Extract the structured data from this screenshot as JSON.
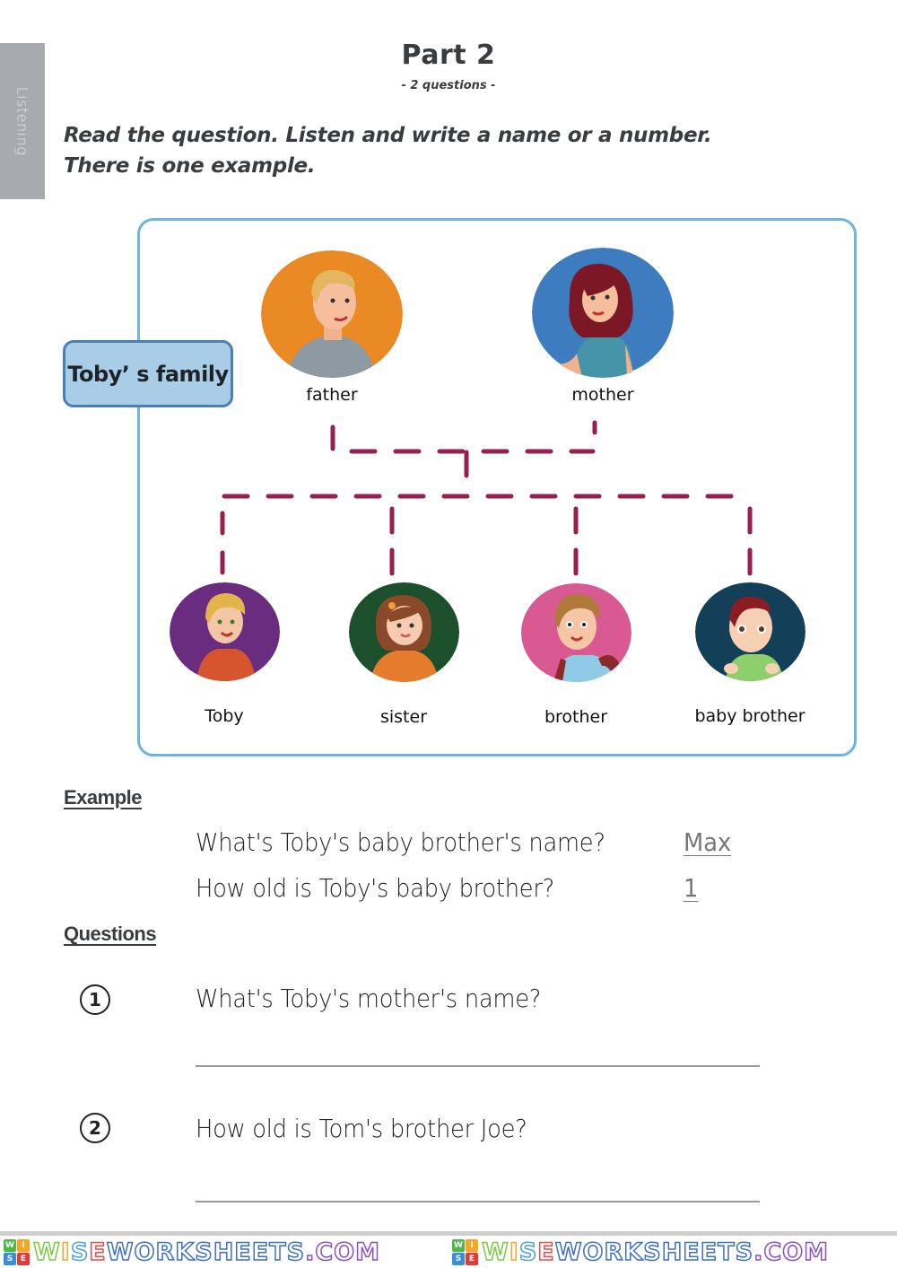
{
  "side_tab": {
    "label": "Listening"
  },
  "header": {
    "title": "Part 2",
    "subtitle": "- 2 questions -",
    "instruction_line1": "Read the question. Listen and write a name or a number.",
    "instruction_line2": "There is one example."
  },
  "family": {
    "tag": "Toby’ s family",
    "parents": [
      {
        "label": "father",
        "bg_color": "#e98a25"
      },
      {
        "label": "mother",
        "bg_color": "#3c7cbf"
      }
    ],
    "children": [
      {
        "label": "Toby",
        "bg_color": "#6a2c7e"
      },
      {
        "label": "sister",
        "bg_color": "#1c4f2c"
      },
      {
        "label": "brother",
        "bg_color": "#d95a93"
      },
      {
        "label": "baby brother",
        "bg_color": "#143f58"
      }
    ],
    "line_color": "#96204f",
    "box_border_color": "#6bb5de"
  },
  "example": {
    "heading": "Example",
    "items": [
      {
        "question": "What's Toby's baby brother's name?",
        "answer": "Max"
      },
      {
        "question": "How old is Toby's baby brother?",
        "answer": "1"
      }
    ]
  },
  "questions": {
    "heading": "Questions",
    "items": [
      {
        "number": "1",
        "question": "What's Toby's mother's name?",
        "answer": ""
      },
      {
        "number": "2",
        "question": "How old is Tom's brother Joe?",
        "answer": ""
      }
    ]
  },
  "footer": {
    "logo_letters": [
      "W",
      "I",
      "S",
      "E"
    ],
    "logo_colors": [
      "#4db848",
      "#f6a623",
      "#3a8fd9",
      "#e53935"
    ],
    "brand_text": "WISEWORKSHEETS.COM",
    "brand_colors": [
      "#7ac943",
      "#f7a52b",
      "#4aa3df",
      "#e84b4b",
      "#3f6fc5",
      "#3f6fc5",
      "#3f6fc5",
      "#3f6fc5",
      "#3f6fc5",
      "#3f6fc5",
      "#3f6fc5",
      "#3f6fc5",
      "#3f6fc5",
      "#3f6fc5",
      "#8b4fc8",
      "#8b4fc8",
      "#8b4fc8",
      "#8b4fc8"
    ]
  }
}
